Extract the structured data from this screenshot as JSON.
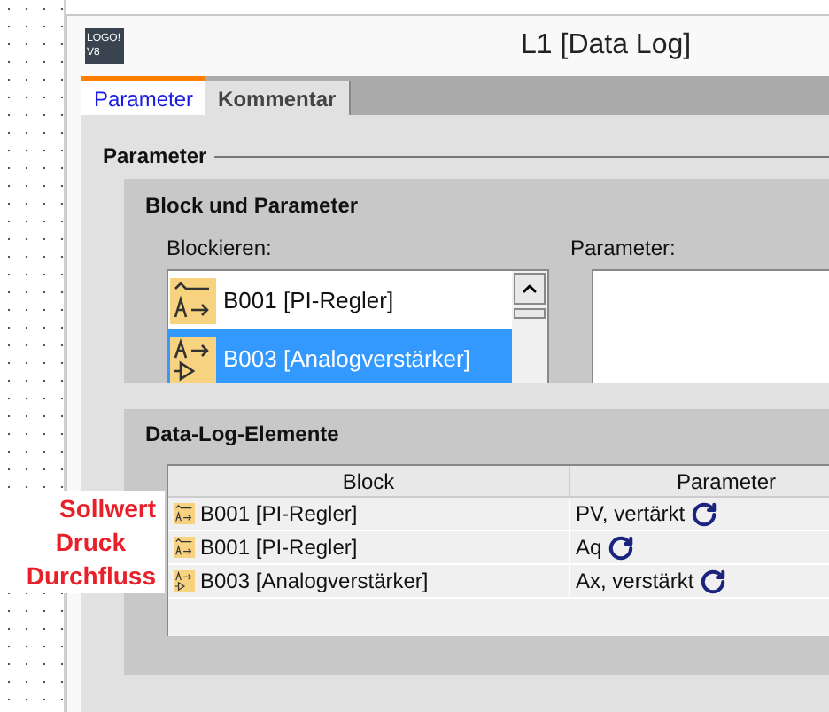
{
  "window": {
    "logo": "LOGO! V8",
    "title": "L1 [Data Log]"
  },
  "tabs": [
    {
      "label": "Parameter",
      "selected": true
    },
    {
      "label": "Kommentar",
      "selected": false
    }
  ],
  "parameter_group": {
    "title": "Parameter"
  },
  "block_panel": {
    "title": "Block und Parameter",
    "blocks_label": "Blockieren:",
    "params_label": "Parameter:",
    "blocks": [
      {
        "kind": "pi",
        "label": "B001 [PI-Regler]",
        "selected": false
      },
      {
        "kind": "amp",
        "label": "B003 [Analogverstärker]",
        "selected": true
      }
    ]
  },
  "data_log": {
    "title": "Data-Log-Elemente",
    "columns": [
      "Block",
      "Parameter"
    ],
    "rows": [
      {
        "kind": "pi",
        "block": "B001 [PI-Regler]",
        "parameter": "PV, vertärkt"
      },
      {
        "kind": "pi",
        "block": "B001 [PI-Regler]",
        "parameter": "Aq"
      },
      {
        "kind": "amp",
        "block": "B003 [Analogverstärker]",
        "parameter": "Ax, verstärkt"
      }
    ]
  },
  "annotations": [
    "Sollwert",
    "Druck",
    "Durchfluss"
  ]
}
